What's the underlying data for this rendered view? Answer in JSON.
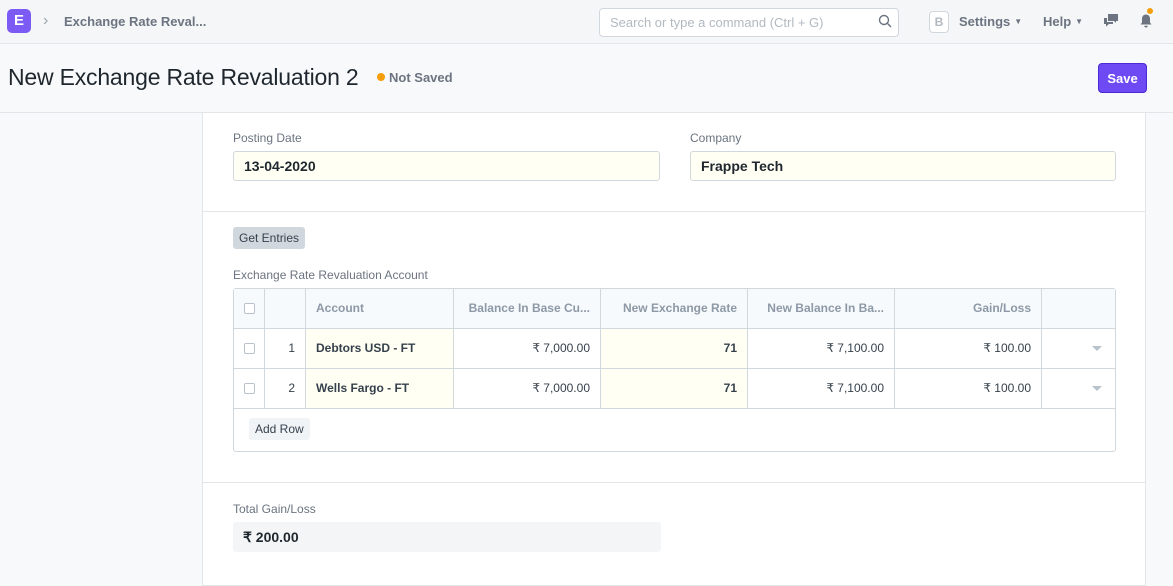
{
  "navbar": {
    "logo": "E",
    "breadcrumb": "Exchange Rate Reval...",
    "search_placeholder": "Search or type a command (Ctrl + G)",
    "avatar_letter": "B",
    "settings_label": "Settings",
    "help_label": "Help"
  },
  "page": {
    "title": "New Exchange Rate Revaluation 2",
    "status": "Not Saved",
    "save_label": "Save"
  },
  "form": {
    "posting_date_label": "Posting Date",
    "posting_date_value": "13-04-2020",
    "company_label": "Company",
    "company_value": "Frappe Tech",
    "get_entries_label": "Get Entries",
    "table_label": "Exchange Rate Revaluation Account",
    "columns": [
      "Account",
      "Balance In Base Cu...",
      "New Exchange Rate",
      "New Balance In Ba...",
      "Gain/Loss"
    ],
    "rows": [
      {
        "no": "1",
        "account": "Debtors USD - FT",
        "balance": "₹ 7,000.00",
        "rate": "71",
        "new_balance": "₹ 7,100.00",
        "gain": "₹ 100.00"
      },
      {
        "no": "2",
        "account": "Wells Fargo - FT",
        "balance": "₹ 7,000.00",
        "rate": "71",
        "new_balance": "₹ 7,100.00",
        "gain": "₹ 100.00"
      }
    ],
    "add_row_label": "Add Row",
    "total_label": "Total Gain/Loss",
    "total_value": "₹ 200.00"
  },
  "colors": {
    "accent": "#6e4af5",
    "status_dot": "#f59e0b",
    "logo_bg": "#7c5bf5"
  }
}
